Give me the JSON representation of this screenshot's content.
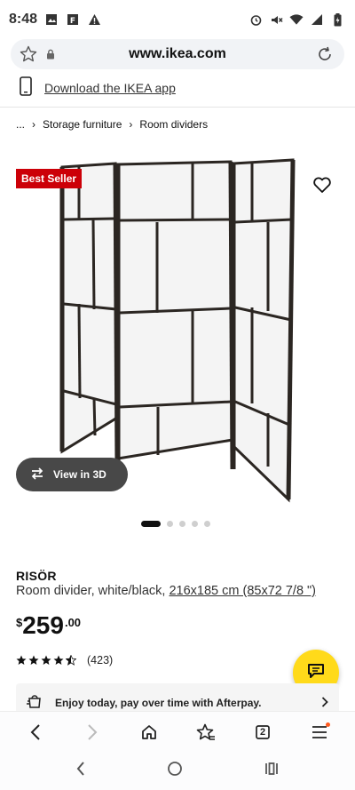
{
  "status_bar": {
    "time": "8:48",
    "icons": [
      "image-icon",
      "font-icon",
      "warning-icon",
      "alarm-icon",
      "mute-icon",
      "wifi-icon",
      "signal-icon",
      "battery-icon"
    ]
  },
  "browser": {
    "url": "www.ikea.com",
    "tab_count": "2"
  },
  "app_banner": {
    "link_label": "Download the IKEA app"
  },
  "breadcrumb": {
    "ellipsis": "...",
    "items": [
      "Storage furniture",
      "Room dividers"
    ]
  },
  "product": {
    "badge": "Best Seller",
    "view_3d_label": "View in 3D",
    "image_count": 5,
    "active_image": 1,
    "name": "RISÖR",
    "description": "Room divider, white/black, ",
    "dimensions": "216x185 cm (85x72 7/8 \")",
    "price_currency": "$",
    "price_integer": "259",
    "price_decimal": ".00",
    "rating_stars": 4.5,
    "review_count": "(423)",
    "afterpay_text": "Enjoy today, pay over time with Afterpay."
  },
  "colors": {
    "badge_red": "#cc0008",
    "chat_yellow": "#ffda1a",
    "frame_dark": "#2b2622",
    "panel_paper": "#f4f4f4"
  }
}
